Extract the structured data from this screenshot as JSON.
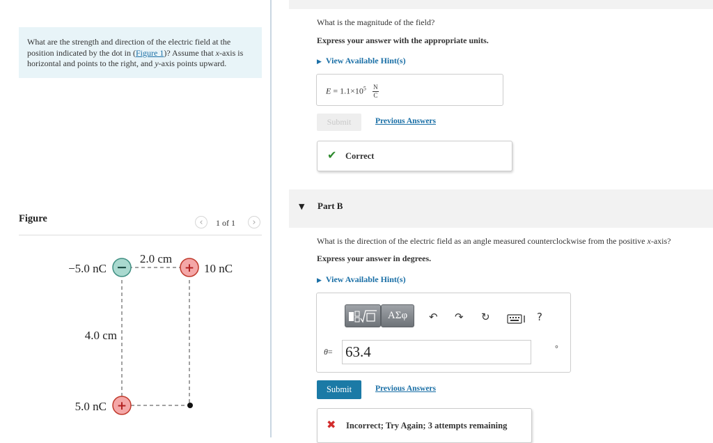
{
  "question": {
    "text_before_link": "What are the strength and direction of the electric field at the position indicated by the dot in (",
    "figure_link": "Figure 1",
    "text_after_link": ")? Assume that ",
    "x_var": "x",
    "text_mid": "-axis is horizontal and points to the right, and ",
    "y_var": "y",
    "text_end": "-axis points upward."
  },
  "figure": {
    "title": "Figure",
    "page_counter": "1 of 1",
    "prev_icon": "chevron-left-icon",
    "next_icon": "chevron-right-icon",
    "charges": {
      "top_left": {
        "label": "−5.0 nC",
        "sign": "−",
        "color": "#a9d9cf"
      },
      "top_right": {
        "label": "10 nC",
        "sign": "+",
        "color": "#f4a7a7"
      },
      "bottom_left": {
        "label": "5.0 nC",
        "sign": "+",
        "color": "#f4a7a7"
      }
    },
    "dim_horizontal": "2.0 cm",
    "dim_vertical": "4.0 cm"
  },
  "part_a": {
    "question": "What is the magnitude of the field?",
    "instruction": "Express your answer with the appropriate units.",
    "hint_link": "View Available Hint(s)",
    "answer_var": "E",
    "answer_eq": "= ",
    "answer_mantissa": "1.1×10",
    "answer_exp": "5",
    "answer_unit_num": "N",
    "answer_unit_den": "C",
    "submit_label": "Submit",
    "previous_answers": "Previous Answers",
    "feedback": "Correct"
  },
  "part_b": {
    "label": "Part B",
    "question_before": "What is the direction of the electric field as an angle measured counterclockwise from the positive ",
    "question_var": "x",
    "question_after": "-axis?",
    "instruction": "Express your answer in degrees.",
    "hint_link": "View Available Hint(s)",
    "toolbar": {
      "templates_icon": "math-templates-icon",
      "symbols_label": "ΑΣφ",
      "undo_icon": "undo-icon",
      "redo_icon": "redo-icon",
      "reset_icon": "reset-icon",
      "keyboard_icon": "keyboard-icon",
      "help_label": "?"
    },
    "input_var": "θ",
    "input_eq": "=",
    "input_value": "63.4",
    "unit": "°",
    "submit_label": "Submit",
    "previous_answers": "Previous Answers",
    "feedback": "Incorrect; Try Again; 3 attempts remaining"
  },
  "colors": {
    "link": "#1a6fa6",
    "submit_active": "#1b7aa6",
    "correct": "#2d8a2d",
    "incorrect": "#d22c2c",
    "question_bg": "#e8f4f8"
  }
}
